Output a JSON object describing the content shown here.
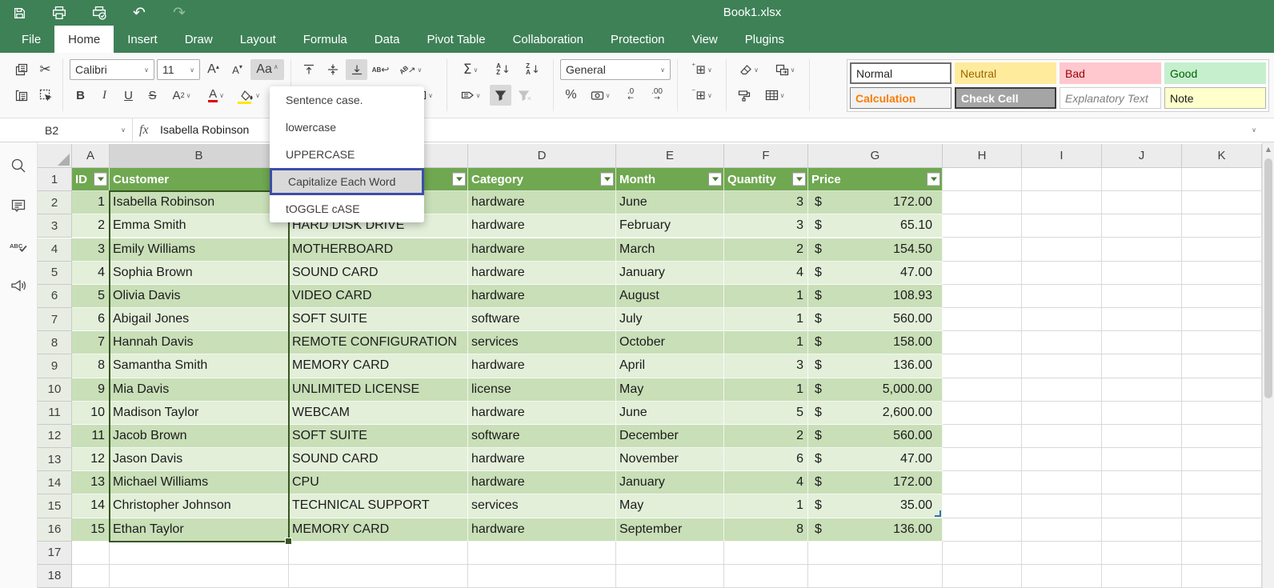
{
  "app": {
    "title": "Book1.xlsx",
    "theme_green": "#3E8157",
    "highlight_blue": "#3C4EA8"
  },
  "menu_tabs": [
    "File",
    "Home",
    "Insert",
    "Draw",
    "Layout",
    "Formula",
    "Data",
    "Pivot Table",
    "Collaboration",
    "Protection",
    "View",
    "Plugins"
  ],
  "active_tab": "Home",
  "ribbon": {
    "font_name": "Calibri",
    "font_size": "11",
    "number_format": "General",
    "buttons": {
      "bold": "B",
      "italic": "I",
      "underline": "U",
      "strikethrough": "S",
      "grow_font": "A",
      "shrink_font": "A",
      "change_case": "Aa",
      "subscript_base": "A",
      "subscript_n": "2",
      "font_color": "A",
      "sum": "Σ",
      "percent": "%",
      "decrease_decimal": ".0",
      "increase_decimal": ".00",
      "ab_label": "AB"
    },
    "sort_letters": [
      "A",
      "Z"
    ],
    "styles_gallery": [
      {
        "name": "Normal",
        "bg": "#FFFFFF",
        "color": "#262626",
        "border": "#6E6E6E",
        "border_w": 2
      },
      {
        "name": "Neutral",
        "bg": "#FFEB9C",
        "color": "#9C6500"
      },
      {
        "name": "Bad",
        "bg": "#FFC7CE",
        "color": "#9C0006"
      },
      {
        "name": "Good",
        "bg": "#C6EFCE",
        "color": "#006100"
      },
      {
        "name": "Calculation",
        "bg": "#F2F2F2",
        "color": "#FA7D00",
        "bold": true,
        "border": "#7F7F7F"
      },
      {
        "name": "Check Cell",
        "bg": "#A5A5A5",
        "color": "#FFFFFF",
        "bold": true,
        "border": "#3C3C3C",
        "border_w": 2
      },
      {
        "name": "Explanatory Text",
        "bg": "#FFFFFF",
        "color": "#7F7F7F",
        "italic": true,
        "border": "#D0D0D0"
      },
      {
        "name": "Note",
        "bg": "#FFFFCC",
        "color": "#1A1A1A",
        "border": "#B2B2B2"
      }
    ]
  },
  "case_menu": {
    "items": [
      "Sentence case.",
      "lowercase",
      "UPPERCASE",
      "Capitalize Each Word",
      "tOGGLE cASE"
    ],
    "highlighted_index": 3
  },
  "formula_bar": {
    "name_box": "B2",
    "fx_label": "fx",
    "content": "Isabella Robinson"
  },
  "sheet": {
    "columns": [
      "A",
      "B",
      "C",
      "D",
      "E",
      "F",
      "G",
      "H",
      "I",
      "J",
      "K"
    ],
    "selected_column": "B",
    "selected_range": "B2:B16",
    "row_count": 18,
    "currency_symbol": "$",
    "colors": {
      "table_header_bg": "#6FA850",
      "band_dark": "#C9DFB8",
      "band_light": "#E3EFD9",
      "selection_border": "#375623"
    },
    "table_header": {
      "id": "ID",
      "customer": "Customer",
      "product": "",
      "category": "Category",
      "month": "Month",
      "quantity": "Quantity",
      "price": "Price"
    },
    "rows": [
      {
        "id": 1,
        "customer": "Isabella Robinson",
        "product": "",
        "category": "hardware",
        "month": "June",
        "quantity": 3,
        "price": "172.00"
      },
      {
        "id": 2,
        "customer": "Emma Smith",
        "product": "HARD DISK DRIVE",
        "category": "hardware",
        "month": "February",
        "quantity": 3,
        "price": "65.10"
      },
      {
        "id": 3,
        "customer": "Emily Williams",
        "product": "MOTHERBOARD",
        "category": "hardware",
        "month": "March",
        "quantity": 2,
        "price": "154.50"
      },
      {
        "id": 4,
        "customer": "Sophia Brown",
        "product": "SOUND CARD",
        "category": "hardware",
        "month": "January",
        "quantity": 4,
        "price": "47.00"
      },
      {
        "id": 5,
        "customer": "Olivia Davis",
        "product": "VIDEO CARD",
        "category": "hardware",
        "month": "August",
        "quantity": 1,
        "price": "108.93"
      },
      {
        "id": 6,
        "customer": "Abigail Jones",
        "product": "SOFT SUITE",
        "category": "software",
        "month": "July",
        "quantity": 1,
        "price": "560.00"
      },
      {
        "id": 7,
        "customer": "Hannah Davis",
        "product": "REMOTE CONFIGURATION",
        "category": "services",
        "month": "October",
        "quantity": 1,
        "price": "158.00"
      },
      {
        "id": 8,
        "customer": "Samantha Smith",
        "product": "MEMORY CARD",
        "category": "hardware",
        "month": "April",
        "quantity": 3,
        "price": "136.00"
      },
      {
        "id": 9,
        "customer": "Mia Davis",
        "product": "UNLIMITED LICENSE",
        "category": "license",
        "month": "May",
        "quantity": 1,
        "price": "5,000.00"
      },
      {
        "id": 10,
        "customer": "Madison Taylor",
        "product": "WEBCAM",
        "category": "hardware",
        "month": "June",
        "quantity": 5,
        "price": "2,600.00"
      },
      {
        "id": 11,
        "customer": "Jacob Brown",
        "product": "SOFT SUITE",
        "category": "software",
        "month": "December",
        "quantity": 2,
        "price": "560.00"
      },
      {
        "id": 12,
        "customer": "Jason Davis",
        "product": "SOUND CARD",
        "category": "hardware",
        "month": "November",
        "quantity": 6,
        "price": "47.00"
      },
      {
        "id": 13,
        "customer": "Michael Williams",
        "product": "CPU",
        "category": "hardware",
        "month": "January",
        "quantity": 4,
        "price": "172.00"
      },
      {
        "id": 14,
        "customer": "Christopher Johnson",
        "product": "TECHNICAL SUPPORT",
        "category": "services",
        "month": "May",
        "quantity": 1,
        "price": "35.00"
      },
      {
        "id": 15,
        "customer": "Ethan Taylor",
        "product": "MEMORY CARD",
        "category": "hardware",
        "month": "September",
        "quantity": 8,
        "price": "136.00"
      }
    ]
  }
}
